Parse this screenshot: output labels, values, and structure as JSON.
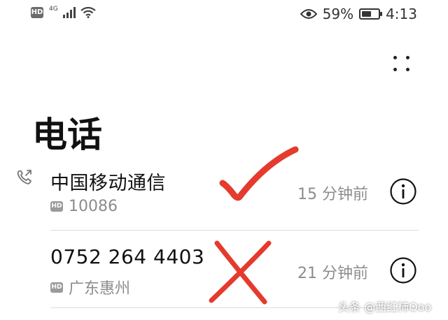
{
  "status_bar": {
    "hd": "HD",
    "network": "4G",
    "battery_percent": "59%",
    "battery_level": 0.59,
    "time": "4:13",
    "icons": [
      "signal-icon",
      "wifi-icon",
      "eye-icon",
      "battery-icon"
    ]
  },
  "header": {
    "title": "电话",
    "menu_icon": "four-dot-menu-icon"
  },
  "calls": [
    {
      "name": "中国移动通信",
      "hd": "HD",
      "number": "10086",
      "time": "15 分钟前",
      "icon": "outgoing-call-icon"
    },
    {
      "name": "0752 264 4403",
      "hd": "HD",
      "location": "广东惠州",
      "time": "21 分钟前"
    }
  ],
  "annotations": {
    "check_color": "#e53a2e",
    "cross_color": "#e53a2e"
  },
  "watermark": "头条 @西红柿Ooo"
}
